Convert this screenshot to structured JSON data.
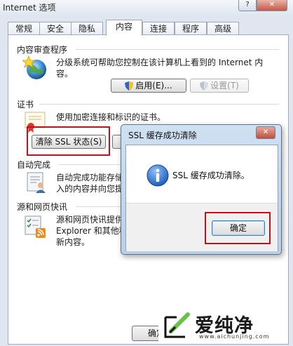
{
  "window": {
    "title": "Internet 选项",
    "help_label": "?",
    "close_label": "✕"
  },
  "tabs": [
    {
      "label": "常规"
    },
    {
      "label": "安全"
    },
    {
      "label": "隐私"
    },
    {
      "label": "内容",
      "active": true
    },
    {
      "label": "连接"
    },
    {
      "label": "程序"
    },
    {
      "label": "高级"
    }
  ],
  "content_advisor": {
    "title": "内容审查程序",
    "text_line1": "分级系统可帮助您控制在该计算机上看到的 Internet 内",
    "text_line2": "容。",
    "enable_label": "启用(E)...",
    "settings_label": "设置(T)"
  },
  "certificates": {
    "title": "证书",
    "text": "使用加密连接和标识的证书。",
    "clear_ssl_label": "清除 SSL 状态(S)"
  },
  "autocomplete": {
    "title": "自动完成",
    "text_line1": "自动完成功能存储",
    "text_line2": "入的内容并向您提"
  },
  "feeds": {
    "title": "源和网页快讯",
    "text_line1": "源和网页快讯提供",
    "text_line2": "Explorer 和其他程",
    "text_line3": "新内容。"
  },
  "footer": {
    "ok_label": "确定"
  },
  "dialog": {
    "title": "SSL 缓存成功清除",
    "message": "SSL 缓存成功清除。",
    "ok_label": "确定"
  },
  "watermark": {
    "brand": "爱纯净",
    "url": "www.aichunjing.com"
  },
  "colors": {
    "highlight": "#c4101a",
    "info_icon": "#1f5fb8"
  }
}
